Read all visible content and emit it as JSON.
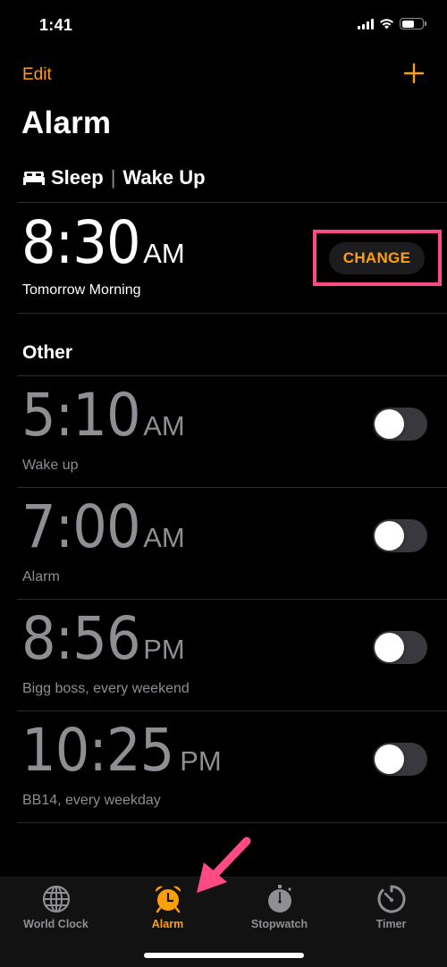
{
  "status_bar": {
    "time": "1:41",
    "icons": [
      "cellular-signal-icon",
      "wifi-icon",
      "battery-icon"
    ]
  },
  "nav": {
    "edit_label": "Edit",
    "add_icon": "plus-icon"
  },
  "page": {
    "title": "Alarm"
  },
  "sleep": {
    "icon": "bed-icon",
    "title_left": "Sleep",
    "separator": "|",
    "title_right": "Wake Up",
    "time": "8:30",
    "period": "AM",
    "label": "Tomorrow Morning",
    "change_label": "CHANGE"
  },
  "other": {
    "header": "Other",
    "alarms": [
      {
        "time": "5:10",
        "period": "AM",
        "label": "Wake up",
        "enabled": false
      },
      {
        "time": "7:00",
        "period": "AM",
        "label": "Alarm",
        "enabled": false
      },
      {
        "time": "8:56",
        "period": "PM",
        "label": "Bigg boss, every weekend",
        "enabled": false
      },
      {
        "time": "10:25",
        "period": "PM",
        "label": "BB14, every weekday",
        "enabled": false
      }
    ]
  },
  "tab_bar": {
    "tabs": [
      {
        "label": "World Clock",
        "icon": "globe-icon",
        "active": false
      },
      {
        "label": "Alarm",
        "icon": "alarm-clock-icon",
        "active": true
      },
      {
        "label": "Stopwatch",
        "icon": "stopwatch-icon",
        "active": false
      },
      {
        "label": "Timer",
        "icon": "timer-icon",
        "active": false
      }
    ]
  },
  "colors": {
    "accent": "#ff9f0a",
    "highlight": "#ff4a86",
    "inactive_text": "#8e8e93",
    "background": "#000000"
  },
  "annotations": {
    "highlight_box": "change-button",
    "arrow_target": "tab-alarm"
  }
}
